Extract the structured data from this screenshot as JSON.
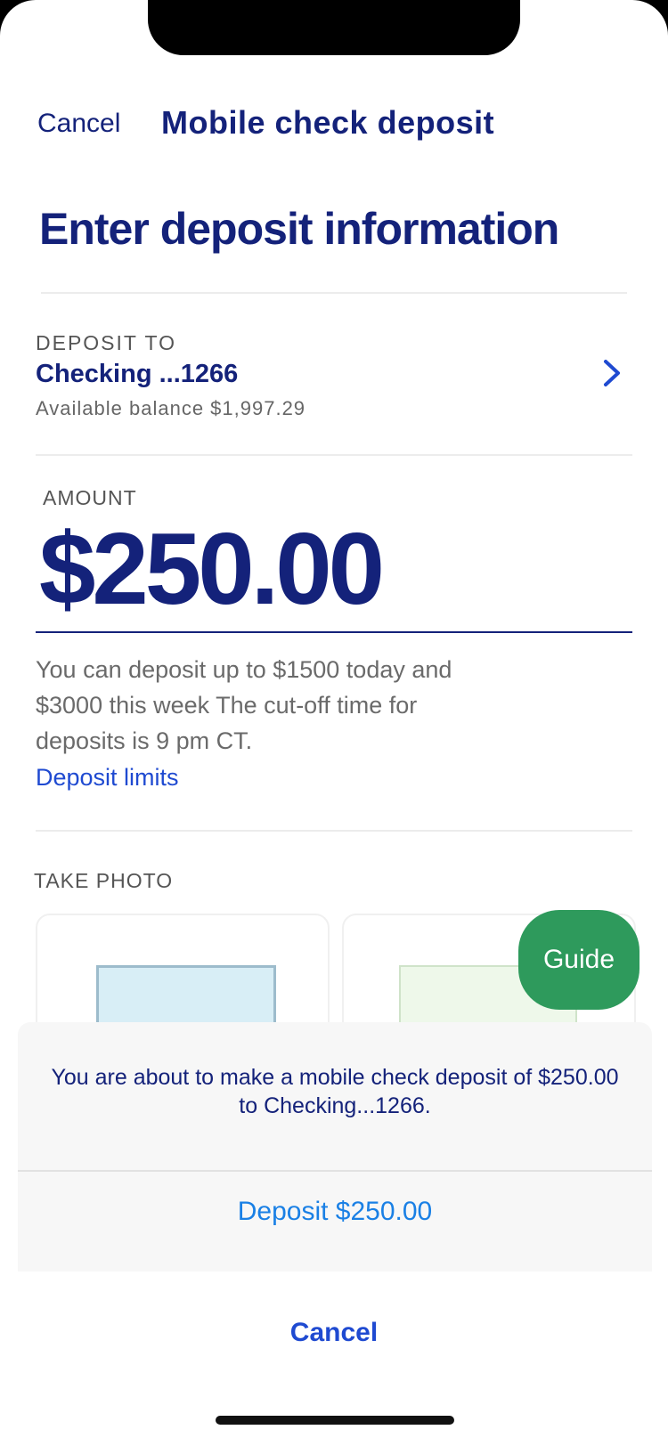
{
  "nav": {
    "cancel_label": "Cancel",
    "title": "Mobile check deposit"
  },
  "page": {
    "heading": "Enter deposit information"
  },
  "deposit_to": {
    "label": "DEPOSIT TO",
    "account": "Checking ...1266",
    "balance": "Available balance $1,997.29"
  },
  "amount": {
    "label": "AMOUNT",
    "value": "$250.00"
  },
  "limits": {
    "text": "You can deposit up to $1500 today and $3000 this week The cut-off time for deposits is 9 pm CT.",
    "link": "Deposit limits"
  },
  "photo": {
    "label": "TAKE PHOTO",
    "guide_label": "Guide"
  },
  "sheet": {
    "message": "You are about to make a mobile check deposit of $250.00 to Checking...1266.",
    "action_label": "Deposit $250.00",
    "cancel_label": "Cancel"
  },
  "colors": {
    "brand_navy": "#14227a",
    "link_blue": "#1f4ad1",
    "action_blue": "#1a80e5",
    "guide_green": "#2e9a5c"
  }
}
